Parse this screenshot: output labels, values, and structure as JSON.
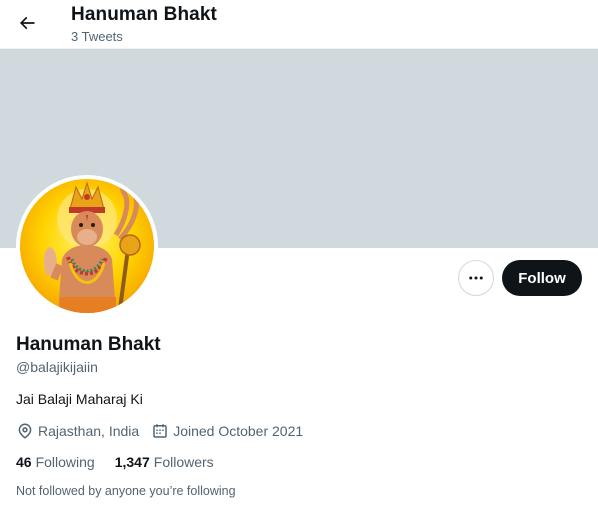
{
  "header": {
    "title": "Hanuman Bhakt",
    "tweet_count": "3 Tweets"
  },
  "colors": {
    "banner": "#cfd9de",
    "primary_text": "#0f1419",
    "secondary_text": "#536471",
    "follow_bg": "#0f1419",
    "follow_text": "#ffffff"
  },
  "actions": {
    "follow_label": "Follow",
    "more_icon": "ellipsis-icon"
  },
  "profile": {
    "name": "Hanuman Bhakt",
    "handle": "@balajikijaiin",
    "bio": "Jai Balaji Maharaj Ki",
    "location": "Rajasthan, India",
    "joined": "Joined October 2021",
    "following_count": "46",
    "following_label": "Following",
    "followers_count": "1,347",
    "followers_label": "Followers",
    "not_followed": "Not followed by anyone you’re following"
  }
}
